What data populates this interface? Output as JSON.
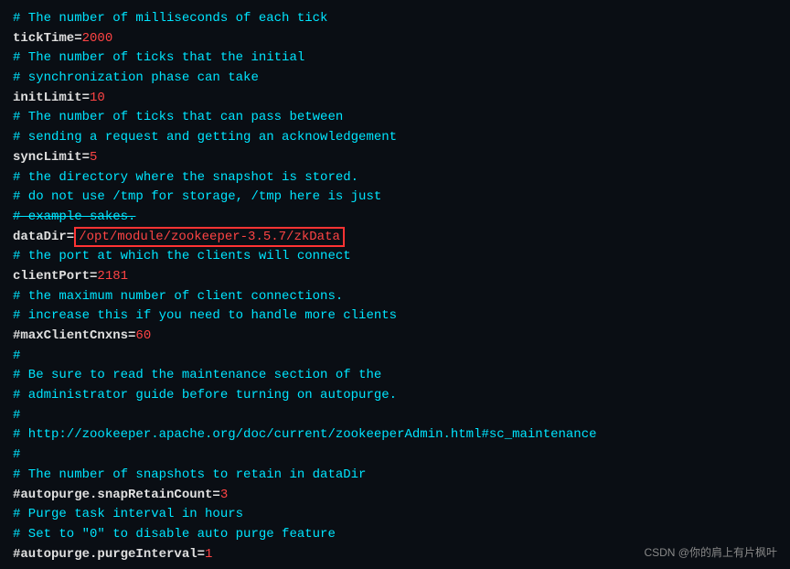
{
  "terminal": {
    "background": "#0a0e14",
    "lines": [
      {
        "type": "comment",
        "text": "# The number of milliseconds of each tick"
      },
      {
        "type": "keyval",
        "key": "tickTime=",
        "value": "2000",
        "valueColor": "red"
      },
      {
        "type": "comment",
        "text": "# The number of ticks that the initial"
      },
      {
        "type": "comment",
        "text": "# synchronization phase can take"
      },
      {
        "type": "keyval",
        "key": "initLimit=",
        "value": "10",
        "valueColor": "red"
      },
      {
        "type": "comment",
        "text": "# The number of ticks that can pass between"
      },
      {
        "type": "comment",
        "text": "# sending a request and getting an acknowledgement"
      },
      {
        "type": "keyval",
        "key": "syncLimit=",
        "value": "5",
        "valueColor": "red"
      },
      {
        "type": "comment",
        "text": "# the directory where the snapshot is stored."
      },
      {
        "type": "comment",
        "text": "# do not use /tmp for storage, /tmp here is just"
      },
      {
        "type": "comment-strike",
        "text": "# example sakes."
      },
      {
        "type": "keyval-highlight",
        "key": "dataDir=",
        "value": "/opt/module/zookeeper-3.5.7/zkData"
      },
      {
        "type": "comment",
        "text": "# the port at which the clients will connect"
      },
      {
        "type": "keyval",
        "key": "clientPort=",
        "value": "2181",
        "valueColor": "red"
      },
      {
        "type": "comment",
        "text": "# the maximum number of client connections."
      },
      {
        "type": "comment",
        "text": "# increase this if you need to handle more clients"
      },
      {
        "type": "keyval",
        "key": "#maxClientCnxns=",
        "value": "60",
        "valueColor": "red"
      },
      {
        "type": "comment",
        "text": "#"
      },
      {
        "type": "comment-hash-blue",
        "text": "# Be sure to read the maintenance section of the"
      },
      {
        "type": "comment",
        "text": "# administrator guide before turning on autopurge."
      },
      {
        "type": "comment",
        "text": "#"
      },
      {
        "type": "comment",
        "text": "# http://zookeeper.apache.org/doc/current/zookeeperAdmin.html#sc_maintenance"
      },
      {
        "type": "comment",
        "text": "#"
      },
      {
        "type": "comment",
        "text": "# The number of snapshots to retain in dataDir"
      },
      {
        "type": "keyval",
        "key": "#autopurge.snapRetainCount=",
        "value": "3",
        "valueColor": "red"
      },
      {
        "type": "comment",
        "text": "# Purge task interval in hours"
      },
      {
        "type": "comment",
        "text": "# Set to \"0\" to disable auto purge feature"
      },
      {
        "type": "keyval",
        "key": "#autopurge.purgeInterval=",
        "value": "1",
        "valueColor": "red"
      }
    ],
    "watermark": "CSDN @你的肩上有片枫叶"
  }
}
